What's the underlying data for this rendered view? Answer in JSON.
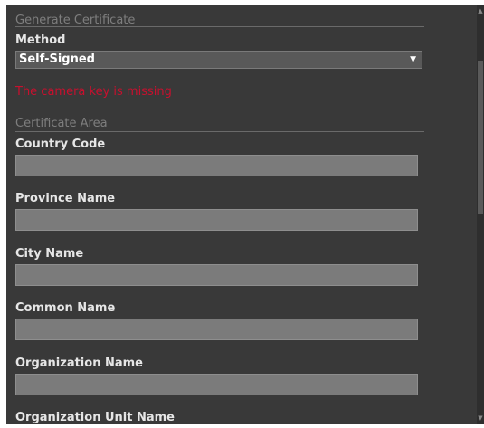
{
  "section_generate": {
    "title": "Generate Certificate"
  },
  "method": {
    "label": "Method",
    "selected_value": "Self-Signed"
  },
  "error_text": "The camera key is missing",
  "section_certificate_area": {
    "title": "Certificate Area"
  },
  "fields": [
    {
      "label": "Country Code",
      "value": ""
    },
    {
      "label": "Province Name",
      "value": ""
    },
    {
      "label": "City Name",
      "value": ""
    },
    {
      "label": "Common Name",
      "value": ""
    },
    {
      "label": "Organization Name",
      "value": ""
    },
    {
      "label": "Organization Unit Name",
      "value": ""
    }
  ],
  "icons": {
    "select_arrow": "chevron-down-icon",
    "scroll_up": "scroll-up-icon",
    "scroll_down": "scroll-down-icon"
  },
  "colors": {
    "background": "#393939",
    "error": "#c8102e",
    "input": "#7b7b7b"
  }
}
